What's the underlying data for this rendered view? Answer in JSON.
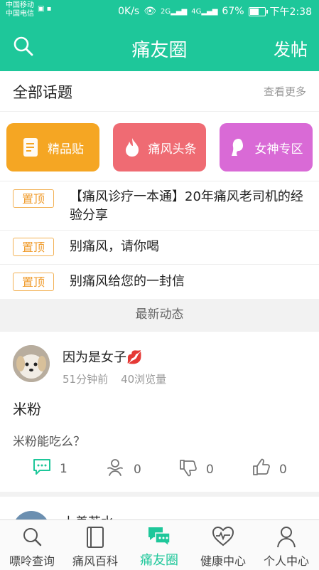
{
  "status_bar": {
    "carrier1": "中国移动",
    "carrier2": "中国电信",
    "speed": "0K/s",
    "signal_label1": "2G",
    "signal_label2": "4G",
    "battery": "67%",
    "time": "下午2:38",
    "battery_level": 0.67
  },
  "app_bar": {
    "title": "痛友圈",
    "post_label": "发帖",
    "search_icon": "search-icon"
  },
  "topics": {
    "header": "全部话题",
    "more": "查看更多",
    "cards": [
      {
        "label": "精品贴",
        "icon": "document-icon",
        "color": "#f5a623"
      },
      {
        "label": "痛风头条",
        "icon": "flame-icon",
        "color": "#ef6b73"
      },
      {
        "label": "女神专区",
        "icon": "woman-profile-icon",
        "color": "#d96ad6"
      }
    ]
  },
  "pinned": [
    {
      "tag": "置顶",
      "title": "【痛风诊疗一本通】20年痛风老司机的经验分享"
    },
    {
      "tag": "置顶",
      "title": "别痛风，请你喝"
    },
    {
      "tag": "置顶",
      "title": "别痛风给您的一封信"
    }
  ],
  "latest": {
    "header": "最新动态",
    "post": {
      "user": "因为是女子💋",
      "time_ago": "51分钟前",
      "views": "40浏览量",
      "title": "米粉",
      "body": "米粉能吃么？",
      "comments": "1",
      "likes": "0",
      "dislikes": "0",
      "thumbs": "0"
    },
    "next_user": "上善若水"
  },
  "tabbar": {
    "tabs": [
      {
        "label": "嘌呤查询",
        "icon": "search-icon"
      },
      {
        "label": "痛风百科",
        "icon": "book-icon"
      },
      {
        "label": "痛友圈",
        "icon": "chat-bubbles-icon"
      },
      {
        "label": "健康中心",
        "icon": "heart-pulse-icon"
      },
      {
        "label": "个人中心",
        "icon": "person-icon"
      }
    ],
    "active_index": 2
  },
  "colors": {
    "brand": "#1ec79a",
    "pin_tag": "#f09b2b"
  }
}
